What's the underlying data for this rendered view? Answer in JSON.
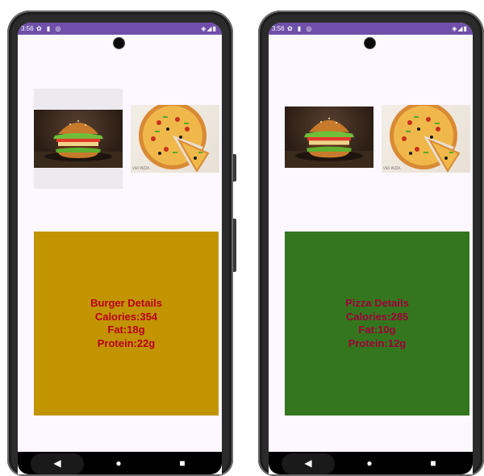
{
  "screens": [
    {
      "status_bar": {
        "time": "3:56",
        "left_icons": "✿ ▮ ◎",
        "right_icons": "◈◢▮"
      },
      "images": [
        {
          "name": "burger",
          "caption": ""
        },
        {
          "name": "pizza",
          "caption": "VSO PIZZA"
        }
      ],
      "details": {
        "background": "#c29400",
        "title": "Burger Details",
        "calories": "Calories:354",
        "fat": "Fat:18g",
        "protein": "Protein:22g"
      },
      "nav": {
        "back": "◀",
        "home": "●",
        "recent": "■"
      }
    },
    {
      "status_bar": {
        "time": "3:56",
        "left_icons": "✿ ▮ ◎",
        "right_icons": "◈◢▮"
      },
      "images": [
        {
          "name": "burger",
          "caption": ""
        },
        {
          "name": "pizza",
          "caption": "VSO PIZZA"
        }
      ],
      "details": {
        "background": "#34761e",
        "title": "Pizza Details",
        "calories": "Calories:285",
        "fat": "Fat:10g",
        "protein": "Protein:12g"
      },
      "nav": {
        "back": "◀",
        "home": "●",
        "recent": "■"
      }
    }
  ]
}
